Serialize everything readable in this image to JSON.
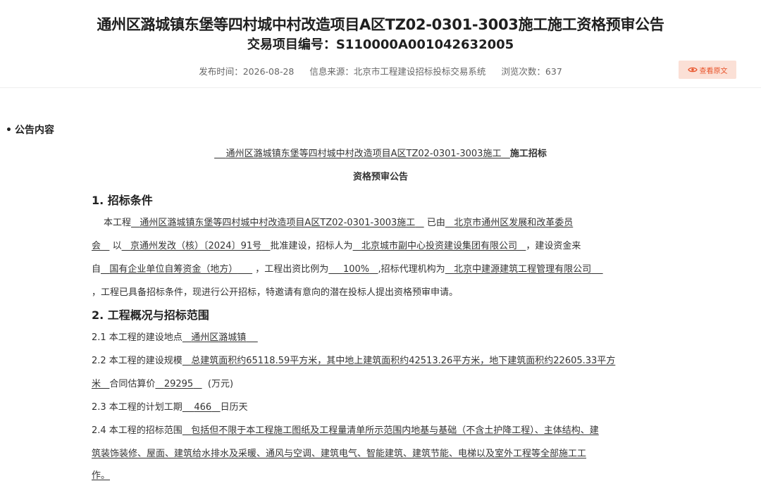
{
  "header": {
    "title": "通州区潞城镇东堡等四村城中村改造项目A区TZ02-0301-3003施工施工资格预审公告",
    "project_no_label": "交易项目编号：",
    "project_no": "S110000A001042632005",
    "publish_label": "发布时间：",
    "publish_date": "2026-08-28",
    "source_label": "信息来源：",
    "source": "北京市工程建设招标投标交易系统",
    "views_label": "浏览次数：",
    "views": "637",
    "view_original": "查看原文"
  },
  "section_title": "公告内容",
  "doc": {
    "title_line1_project": "通州区潞城镇东堡等四村城中村改造项目A区TZ02-0301-3003施工",
    "title_line1_suffix": "施工招标",
    "title_line2": "资格预审公告",
    "s1_heading": "1. 招标条件",
    "p1": {
      "a": "本工程",
      "project": "通州区潞城镇东堡等四村城中村改造项目A区TZ02-0301-3003施工",
      "b": "已由",
      "approver_1": "北京市通州区发展和改革委员",
      "approver_2": "会",
      "c": "以",
      "approval_no": "京通州发改（核）〔2024〕91号",
      "d": "批准建设，招标人为",
      "tenderer": "北京城市副中心投资建设集团有限公司",
      "e": "，建设资金来",
      "f": "自",
      "fund_source": "国有企业单位自筹资金（地方）",
      "g": "，工程出资比例为",
      "ratio": "100%",
      "h": ",招标代理机构为",
      "agent": "北京中建源建筑工程管理有限公司",
      "i": "，工程已具备招标条件，现进行公开招标，特邀请有意向的潜在投标人提出资格预审申请。"
    },
    "s2_heading": "2. 工程概况与招标范围",
    "s21_label": "2.1 本工程的建设地点",
    "s21_value": "通州区潞城镇",
    "s22_label": "2.2 本工程的建设规模",
    "s22_value_1": "总建筑面积约65118.59平方米，其中地上建筑面积约42513.26平方米，地下建筑面积约22605.33平方",
    "s22_value_2": "米",
    "s22_price_label": "合同估算价",
    "s22_price": "29295",
    "s22_unit": "(万元)",
    "s23_label": "2.3 本工程的计划工期",
    "s23_value": "466",
    "s23_unit": "日历天",
    "s24_label": "2.4 本工程的招标范围",
    "s24_value_1": "包括但不限于本工程施工图纸及工程量清单所示范围内地基与基础（不含土护降工程）、主体结构、建",
    "s24_value_2": "筑装饰装修、屋面、建筑给水排水及采暖、通风与空调、建筑电气、智能建筑、建筑节能、电梯以及室外工程等全部施工工",
    "s24_value_3": "作。"
  }
}
